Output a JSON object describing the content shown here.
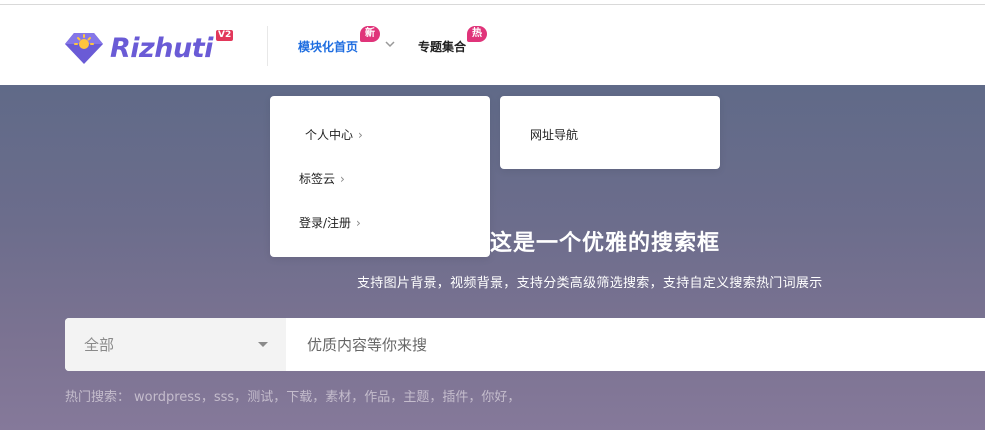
{
  "header": {
    "logo_text": "Rizhuti",
    "logo_badge": "V2",
    "nav": [
      {
        "label": "模块化首页",
        "badge": "新",
        "badge_color": "#e0347a"
      },
      {
        "label": "专题集合",
        "badge": "热",
        "badge_color": "#e0347a"
      }
    ]
  },
  "dropdown": {
    "left_items": [
      {
        "label": "个人中心"
      },
      {
        "label": "标签云"
      },
      {
        "label": "登录/注册"
      }
    ],
    "right_items": [
      {
        "label": "网址导航"
      }
    ]
  },
  "hero": {
    "title": "这是一个优雅的搜索框",
    "subtitle": "支持图片背景，视频背景，支持分类高级筛选搜索，支持自定义搜索热门词展示"
  },
  "search": {
    "category": "全部",
    "placeholder": "优质内容等你来搜"
  },
  "hot": {
    "label": "热门搜索：",
    "keywords": [
      "wordpress",
      "sss",
      "测试",
      "下载",
      "素材",
      "作品",
      "主题",
      "插件",
      "你好"
    ],
    "separator": "，"
  },
  "colors": {
    "accent": "#1e6de0",
    "logo": "#6a5bd6",
    "badge": "#e0347a"
  }
}
